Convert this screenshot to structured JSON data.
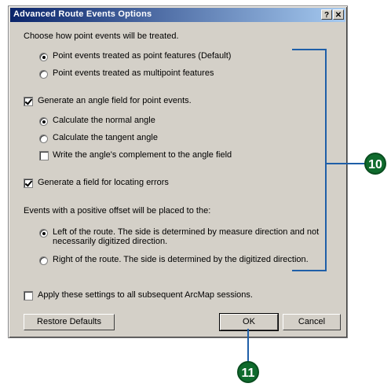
{
  "window": {
    "title": "Advanced Route Events Options",
    "help_btn": "?",
    "close_btn": "✕"
  },
  "point_events": {
    "heading": "Choose how point events will be treated.",
    "options": [
      {
        "label": "Point events treated as point features (Default)",
        "selected": true
      },
      {
        "label": "Point events treated as multipoint features",
        "selected": false
      }
    ]
  },
  "angle": {
    "checkbox_label": "Generate an angle field for point events.",
    "checked": true,
    "options": [
      {
        "label": "Calculate the normal angle",
        "selected": true
      },
      {
        "label": "Calculate the tangent angle",
        "selected": false
      }
    ],
    "complement_label": "Write the angle's complement to the angle field",
    "complement_checked": false
  },
  "errors": {
    "checkbox_label": "Generate a field for locating errors",
    "checked": true
  },
  "offset": {
    "heading": "Events with a positive offset will be placed to the:",
    "left_line1": "Left of the route. The side is determined by measure direction and not",
    "left_line2": "necessarily digitized direction.",
    "right_label": "Right of the route. The side is determined by the digitized direction."
  },
  "apply": {
    "label": "Apply these settings to all subsequent ArcMap sessions.",
    "checked": false
  },
  "buttons": {
    "restore": "Restore Defaults",
    "ok": "OK",
    "cancel": "Cancel"
  },
  "callouts": {
    "bracket_number": "10",
    "ok_number": "11"
  },
  "colors": {
    "callout_line": "#1f5fa8",
    "badge": "#0f6b2d",
    "titlebar": "#0a246a"
  }
}
